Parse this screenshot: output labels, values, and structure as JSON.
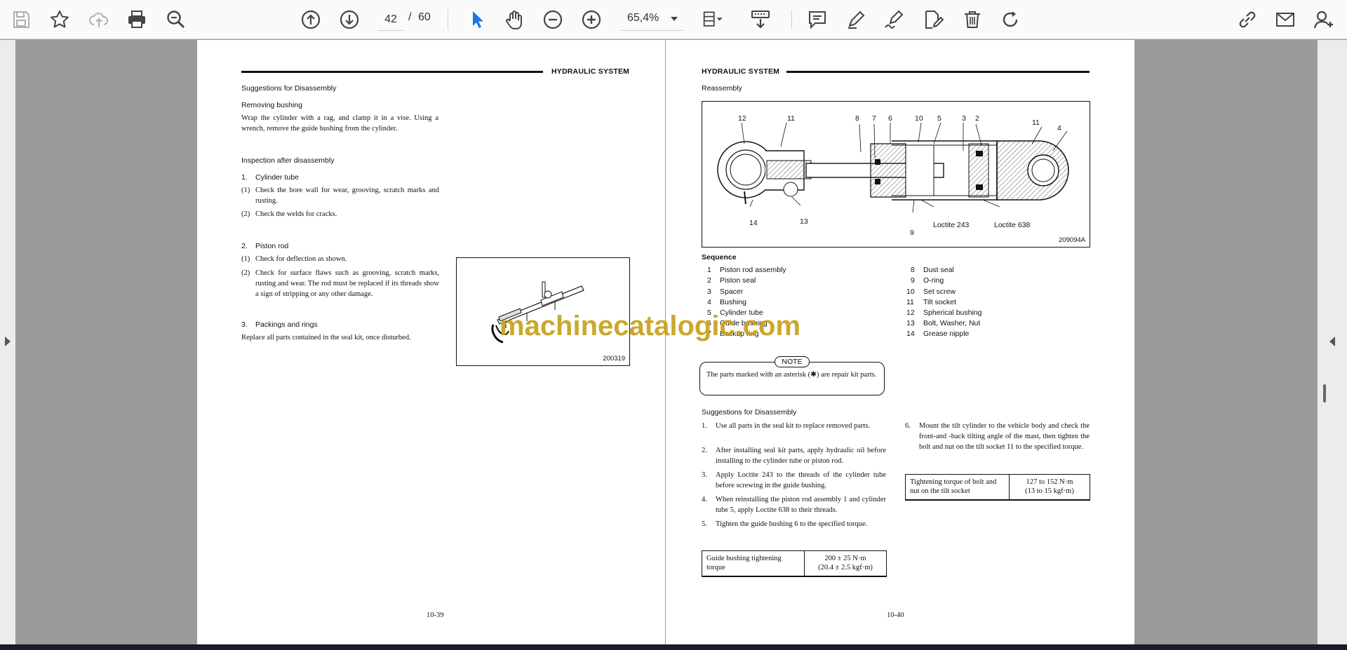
{
  "toolbar": {
    "current_page": "42",
    "page_separator": "/",
    "total_pages": "60",
    "zoom": "65,4%"
  },
  "left_page": {
    "header_title": "HYDRAULIC SYSTEM",
    "s1_title": "Suggestions for Disassembly",
    "s1_sub": "Removing bushing",
    "s1_text": "Wrap the cylinder with a rag, and clamp it in a vise. Using a wrench, remove the guide bushing from the cylinder.",
    "s2_title": "Inspection after disassembly",
    "i1_num": "1.",
    "i1_title": "Cylinder tube",
    "i1_a_num": "(1)",
    "i1_a": "Check the bore wall for wear, grooving, scratch marks and rusting.",
    "i1_b_num": "(2)",
    "i1_b": "Check the welds for cracks.",
    "i2_num": "2.",
    "i2_title": "Piston rod",
    "i2_a_num": "(1)",
    "i2_a": "Check for deflection as shown.",
    "i2_b_num": "(2)",
    "i2_b": "Check for surface flaws such as grooving, scratch marks, rusting and wear. The rod must be replaced if its threads show a sign of stripping or any other damage.",
    "i3_num": "3.",
    "i3_title": "Packings and rings",
    "i3_text": "Replace all parts contained in the seal kit, once disturbed.",
    "figure_id": "200319",
    "page_number": "10-39"
  },
  "right_page": {
    "header_title": "HYDRAULIC SYSTEM",
    "reassembly_title": "Reassembly",
    "figure_id": "209094A",
    "callouts": {
      "c12": "12",
      "c11a": "11",
      "c8": "8",
      "c7": "7",
      "c6": "6",
      "c10": "10",
      "c5": "5",
      "c3": "3",
      "c2": "2",
      "c11b": "11",
      "c4": "4",
      "c14": "14",
      "c13": "13",
      "c9": "9",
      "loctite243": "Loctite 243",
      "loctite638": "Loctite 638"
    },
    "sequence_title": "Sequence",
    "sequence_left": [
      {
        "n": "1",
        "label": "Piston rod assembly"
      },
      {
        "n": "2",
        "label": "Piston seal"
      },
      {
        "n": "3",
        "label": "Spacer"
      },
      {
        "n": "4",
        "label": "Bushing"
      },
      {
        "n": "5",
        "label": "Cylinder tube"
      },
      {
        "n": "6",
        "label": "Guide bushing"
      },
      {
        "n": "7",
        "label": "Backup ring"
      }
    ],
    "sequence_right": [
      {
        "n": "8",
        "label": "Dust seal"
      },
      {
        "n": "9",
        "label": "O-ring"
      },
      {
        "n": "10",
        "label": "Set screw"
      },
      {
        "n": "11",
        "label": "Tilt socket"
      },
      {
        "n": "12",
        "label": "Spherical bushing"
      },
      {
        "n": "13",
        "label": "Bolt, Washer, Nut"
      },
      {
        "n": "14",
        "label": "Grease nipple"
      }
    ],
    "note_label": "NOTE",
    "note_text": "The parts marked with an asterisk (✱) are repair kit parts.",
    "s_title": "Suggestions for Disassembly",
    "steps_left": [
      {
        "n": "1.",
        "text": "Use all parts in the seal kit to replace removed parts."
      },
      {
        "n": "2.",
        "text": "After installing seal kit parts, apply hydraulic oil before installing to the cylinder tube or piston rod."
      },
      {
        "n": "3.",
        "text": "Apply Loctite 243 to the threads of the cylinder tube before screwing in the guide bushing."
      },
      {
        "n": "4.",
        "text": "When reinstalling the piston rod assembly 1 and cylinder tube 5, apply Loctite 638 to their threads."
      },
      {
        "n": "5.",
        "text": "Tighten the guide bushing 6 to the specified torque."
      }
    ],
    "step6_num": "6.",
    "step6_text": "Mount the tilt cylinder to the vehicle body and check the front-and -back tilting angle of the mast, then tighten the bolt and nut on the tilt socket 11 to the specified torque.",
    "table1": {
      "label": "Guide bushing tightening torque",
      "value_a": "200 ± 25 N·m",
      "value_b": "(20.4 ± 2.5 kgf·m)"
    },
    "table2": {
      "label": "Tightening torque of bolt and nut on the tilt socket",
      "value_a": "127 to 152 N·m",
      "value_b": "(13 to 15 kgf·m)"
    },
    "page_number": "10-40"
  },
  "watermark": "machinecatalogic.com",
  "icons": [
    "save-icon",
    "bookmark-star-icon",
    "cloud-upload-icon",
    "print-icon",
    "zoom-search-icon",
    "page-up-icon",
    "page-down-icon",
    "select-pointer-icon",
    "hand-pan-icon",
    "zoom-out-icon",
    "zoom-in-icon",
    "page-view-icon",
    "scroll-mode-icon",
    "comment-icon",
    "highlight-pen-icon",
    "sign-pen-icon",
    "edit-text-icon",
    "delete-icon",
    "rotate-icon",
    "share-link-icon",
    "email-icon",
    "add-user-icon"
  ],
  "colors": {
    "accent": "#1a73e8",
    "watermark": "#c9a422"
  }
}
